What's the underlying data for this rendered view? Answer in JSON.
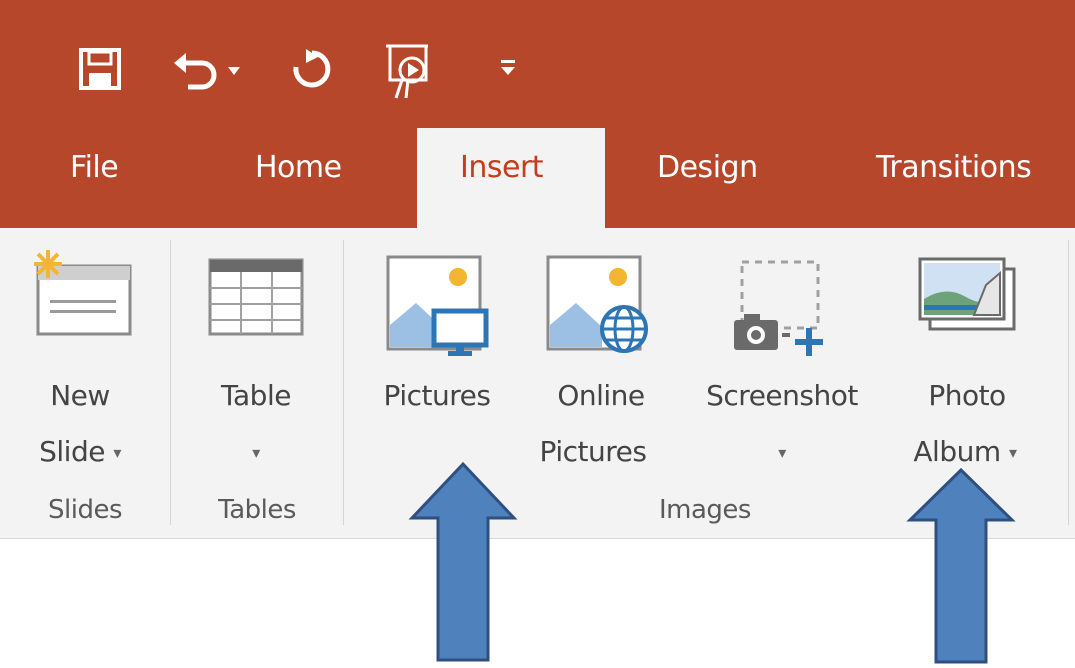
{
  "quick_access": {
    "icons": [
      "save-icon",
      "undo-icon",
      "redo-icon",
      "start-from-beginning-icon",
      "customize-qat-icon"
    ]
  },
  "tabs": [
    {
      "label": "File"
    },
    {
      "label": "Home"
    },
    {
      "label": "Insert",
      "active": true
    },
    {
      "label": "Design"
    },
    {
      "label": "Transitions"
    }
  ],
  "ribbon": {
    "groups": {
      "slides": {
        "label": "Slides",
        "new_slide": {
          "line1": "New",
          "line2": "Slide"
        }
      },
      "tables": {
        "label": "Tables",
        "table": {
          "line1": "Table"
        }
      },
      "images": {
        "label": "Images",
        "pictures": {
          "line1": "Pictures"
        },
        "online_pictures": {
          "line1": "Online",
          "line2": "Pictures"
        },
        "screenshot": {
          "line1": "Screenshot"
        },
        "photo_album": {
          "line1": "Photo",
          "line2": "Album"
        }
      }
    }
  },
  "annotations": {
    "arrow_color": "#4f81bd",
    "arrow_outline": "#2f4f7f"
  },
  "colors": {
    "title_bar": "#b7472a",
    "ribbon_bg": "#f3f3f3",
    "active_tab_text": "#c43e1c"
  }
}
